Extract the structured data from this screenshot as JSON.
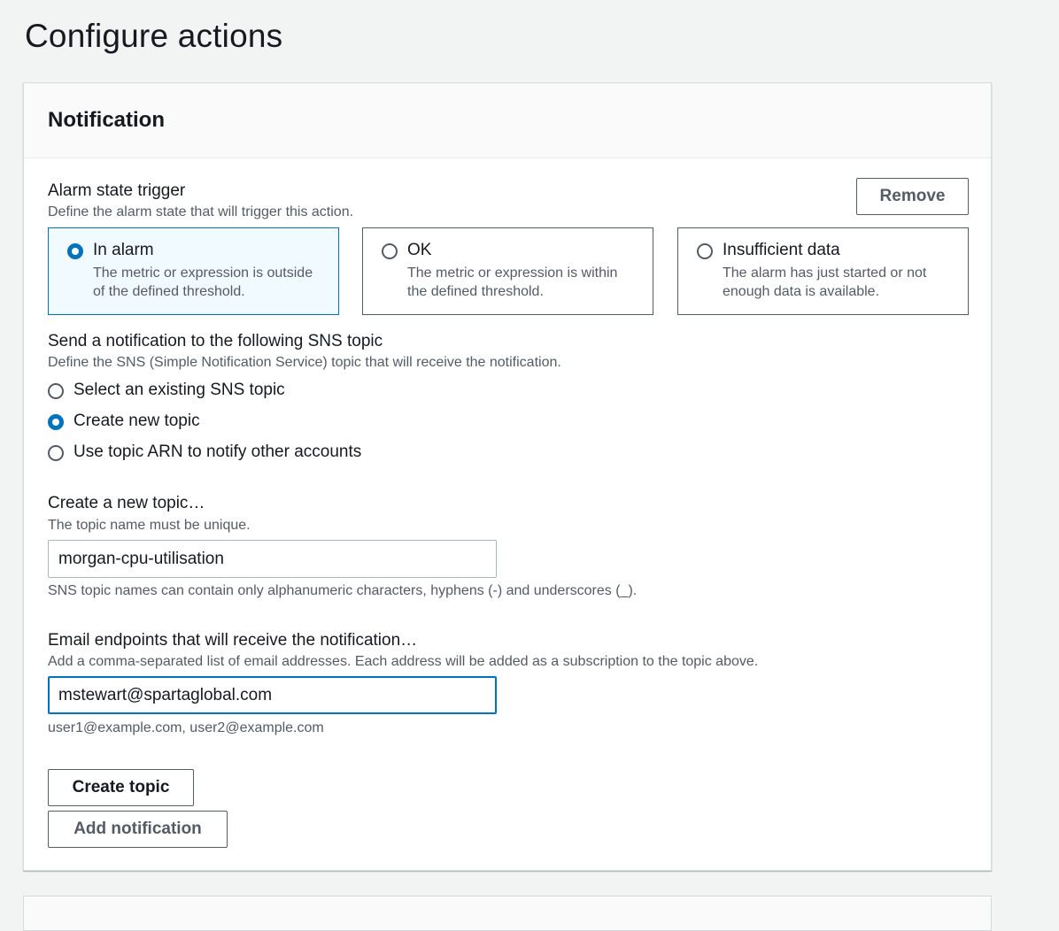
{
  "page": {
    "title": "Configure actions"
  },
  "notification": {
    "title": "Notification",
    "remove_label": "Remove",
    "trigger": {
      "label": "Alarm state trigger",
      "description": "Define the alarm state that will trigger this action.",
      "options": [
        {
          "title": "In alarm",
          "description": "The metric or expression is outside of the defined threshold.",
          "selected": true
        },
        {
          "title": "OK",
          "description": "The metric or expression is within the defined threshold.",
          "selected": false
        },
        {
          "title": "Insufficient data",
          "description": "The alarm has just started or not enough data is available.",
          "selected": false
        }
      ]
    },
    "sns": {
      "label": "Send a notification to the following SNS topic",
      "description": "Define the SNS (Simple Notification Service) topic that will receive the notification.",
      "options": [
        {
          "label": "Select an existing SNS topic",
          "selected": false
        },
        {
          "label": "Create new topic",
          "selected": true
        },
        {
          "label": "Use topic ARN to notify other accounts",
          "selected": false
        }
      ]
    },
    "new_topic": {
      "label": "Create a new topic…",
      "description": "The topic name must be unique.",
      "value": "morgan-cpu-utilisation",
      "constraint": "SNS topic names can contain only alphanumeric characters, hyphens (-) and underscores (_)."
    },
    "email": {
      "label": "Email endpoints that will receive the notification…",
      "description": "Add a comma-separated list of email addresses. Each address will be added as a subscription to the topic above.",
      "value": "mstewart@spartaglobal.com",
      "hint": "user1@example.com, user2@example.com"
    },
    "create_topic_label": "Create topic",
    "add_notification_label": "Add notification"
  },
  "colors": {
    "accent": "#0073bb",
    "selected_tile_bg": "#f1faff",
    "page_bg": "#f2f3f3"
  }
}
